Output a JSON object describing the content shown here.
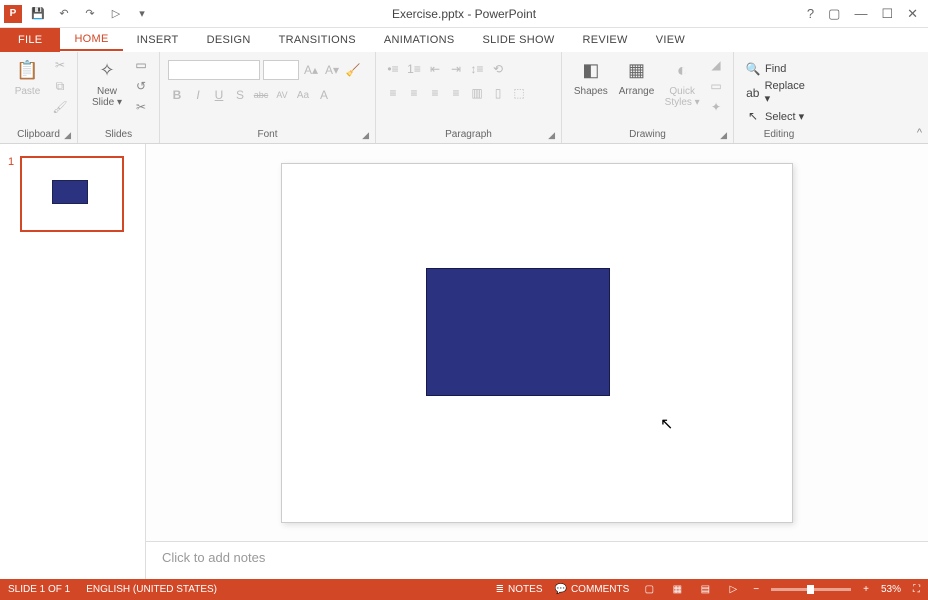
{
  "window": {
    "title": "Exercise.pptx - PowerPoint"
  },
  "qat": {
    "save": "💾",
    "undo": "↶",
    "redo": "↷",
    "start": "▷",
    "more": "▾"
  },
  "tabs": {
    "file": "FILE",
    "home": "HOME",
    "insert": "INSERT",
    "design": "DESIGN",
    "transitions": "TRANSITIONS",
    "animations": "ANIMATIONS",
    "slideshow": "SLIDE SHOW",
    "review": "REVIEW",
    "view": "VIEW"
  },
  "ribbon": {
    "clipboard": {
      "label": "Clipboard",
      "paste": "Paste"
    },
    "slides": {
      "label": "Slides",
      "new_slide": "New\nSlide ▾"
    },
    "font": {
      "label": "Font",
      "buttons": {
        "b": "B",
        "i": "I",
        "u": "U",
        "s": "S",
        "strike": "abc",
        "spacing": "AV",
        "case": "Aa",
        "clear": "A"
      }
    },
    "paragraph": {
      "label": "Paragraph"
    },
    "drawing": {
      "label": "Drawing",
      "shapes": "Shapes",
      "arrange": "Arrange",
      "quick": "Quick\nStyles ▾"
    },
    "editing": {
      "label": "Editing",
      "find": "Find",
      "replace": "Replace ▾",
      "select": "Select ▾"
    }
  },
  "thumbnails": {
    "items": [
      {
        "num": "1"
      }
    ]
  },
  "notes": {
    "placeholder": "Click to add notes"
  },
  "status": {
    "slide": "SLIDE 1 OF 1",
    "lang": "ENGLISH (UNITED STATES)",
    "notes": "NOTES",
    "comments": "COMMENTS",
    "zoom": "53%"
  }
}
